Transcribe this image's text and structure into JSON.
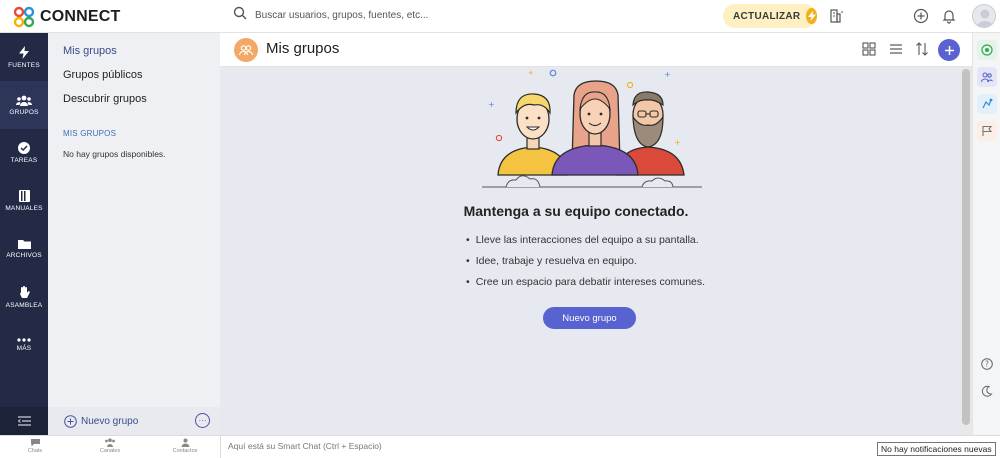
{
  "app": {
    "name": "CONNECT",
    "brand_colors": {
      "accent": "#5862d0",
      "nav_bg": "#232a45",
      "upgrade_bg": "#fdf0c3",
      "header_icon": "#f2a866"
    }
  },
  "topbar": {
    "search_placeholder": "Buscar usuarios, grupos, fuentes, etc...",
    "upgrade_label": "ACTUALIZAR",
    "icons": [
      "search-icon",
      "bolt-icon",
      "building-icon",
      "add-circle-icon",
      "bell-icon",
      "avatar"
    ]
  },
  "leftnav": {
    "items": [
      {
        "label": "FUENTES",
        "icon": "bolt-icon"
      },
      {
        "label": "GRUPOS",
        "icon": "users-icon",
        "active": true
      },
      {
        "label": "TAREAS",
        "icon": "check-circle-icon"
      },
      {
        "label": "MANUALES",
        "icon": "book-icon"
      },
      {
        "label": "ARCHIVOS",
        "icon": "folder-icon"
      },
      {
        "label": "ASAMBLEA",
        "icon": "hand-icon"
      },
      {
        "label": "MÁS",
        "icon": "more-icon"
      }
    ]
  },
  "subpanel": {
    "links": [
      "Mis grupos",
      "Grupos públicos",
      "Descubrir grupos"
    ],
    "section_title": "MIS GRUPOS",
    "empty_text": "No hay grupos disponibles.",
    "new_group_label": "Nuevo grupo",
    "more_label": "···"
  },
  "main": {
    "title": "Mis grupos",
    "heading": "Mantenga a su equipo conectado.",
    "bullets": [
      "Lleve las interacciones del equipo a su pantalla.",
      "Idee, trabaje y resuelva en equipo.",
      "Cree un espacio para debatir intereses comunes."
    ],
    "cta_label": "Nuevo grupo"
  },
  "bottombar": {
    "tabs": [
      "Chats",
      "Canales",
      "Contactos"
    ],
    "smart_chat_placeholder": "Aquí está su Smart Chat (Ctrl + Espacio)",
    "notification_text": "No hay notificaciones nuevas"
  }
}
